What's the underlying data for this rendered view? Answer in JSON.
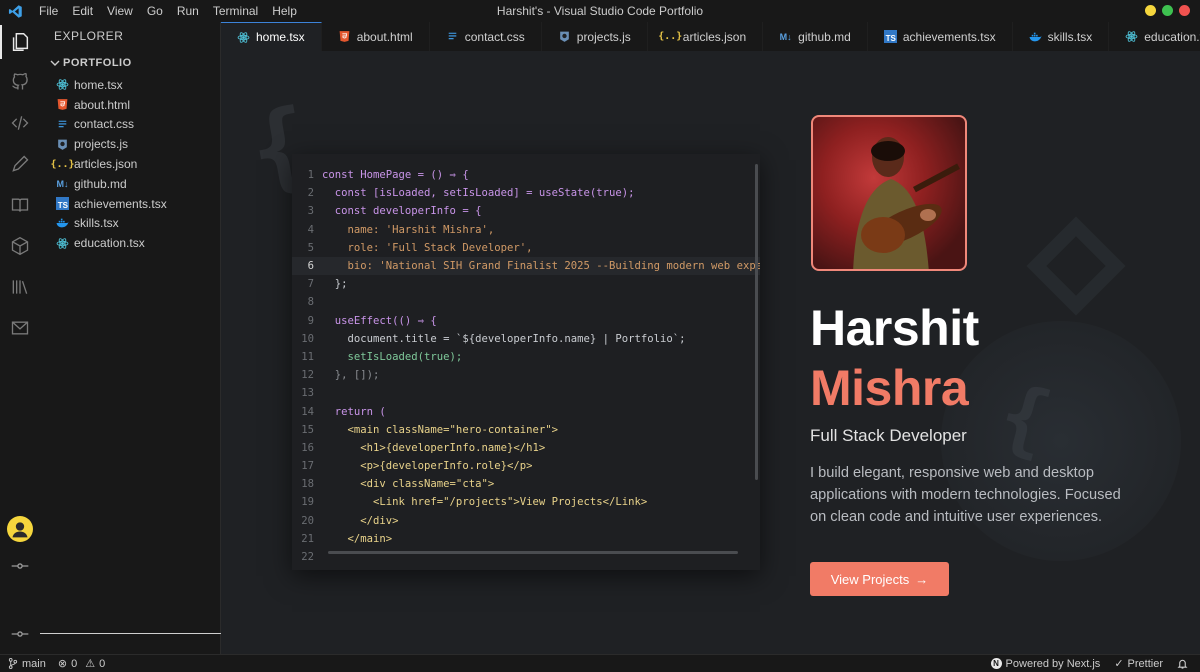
{
  "window": {
    "menu": [
      "File",
      "Edit",
      "View",
      "Go",
      "Run",
      "Terminal",
      "Help"
    ],
    "title": "Harshit's - Visual Studio Code Portfolio",
    "traffic_colors": [
      "#f5d63d",
      "#3ec150",
      "#f0524f"
    ]
  },
  "activity_bar": {
    "icons": [
      "files-icon",
      "github-icon",
      "code-icon",
      "pencil-icon",
      "book-icon",
      "cube-icon",
      "library-icon",
      "mail-icon",
      "avatar",
      "git-commit-icon"
    ]
  },
  "explorer": {
    "title": "EXPLORER",
    "section": "PORTFOLIO",
    "files": [
      {
        "name": "home.tsx",
        "icon": "react-icon"
      },
      {
        "name": "about.html",
        "icon": "html-icon"
      },
      {
        "name": "contact.css",
        "icon": "css-icon"
      },
      {
        "name": "projects.js",
        "icon": "js-icon"
      },
      {
        "name": "articles.json",
        "icon": "json-icon"
      },
      {
        "name": "github.md",
        "icon": "markdown-icon"
      },
      {
        "name": "achievements.tsx",
        "icon": "typescript-icon"
      },
      {
        "name": "skills.tsx",
        "icon": "docker-icon"
      },
      {
        "name": "education.tsx",
        "icon": "react-icon"
      }
    ]
  },
  "tabs": [
    {
      "label": "home.tsx",
      "icon": "react-icon",
      "active": true
    },
    {
      "label": "about.html",
      "icon": "html-icon"
    },
    {
      "label": "contact.css",
      "icon": "css-icon"
    },
    {
      "label": "projects.js",
      "icon": "js-icon"
    },
    {
      "label": "articles.json",
      "icon": "json-icon"
    },
    {
      "label": "github.md",
      "icon": "markdown-icon"
    },
    {
      "label": "achievements.tsx",
      "icon": "typescript-icon"
    },
    {
      "label": "skills.tsx",
      "icon": "docker-icon"
    },
    {
      "label": "education.tsx",
      "icon": "react-icon"
    }
  ],
  "code": {
    "active_line": 6,
    "lines": [
      "const HomePage = () ⇒ {",
      "  const [isLoaded, setIsLoaded] = useState(true);",
      "  const developerInfo = {",
      "    name: 'Harshit Mishra',",
      "    role: 'Full Stack Developer',",
      "    bio: 'National SIH Grand Finalist 2025 --Building modern web expe",
      "  };",
      "",
      "  useEffect(() ⇒ {",
      "    document.title = `${developerInfo.name} | Portfolio`;",
      "    setIsLoaded(true);",
      "  }, []);",
      "",
      "  return (",
      "    <main className=\"hero-container\">",
      "      <h1>{developerInfo.name}</h1>",
      "      <p>{developerInfo.role}</p>",
      "      <div className=\"cta\">",
      "        <Link href=\"/projects\">View Projects</Link>",
      "      </div>",
      "    </main>",
      ""
    ]
  },
  "hero": {
    "first_name": "Harshit",
    "last_name": "Mishra",
    "role": "Full Stack Developer",
    "description": "I build elegant, responsive web and desktop applications with modern technologies. Focused on clean code and intuitive user experiences.",
    "cta_label": "View Projects",
    "cta_arrow": "→",
    "accent": "#f17b66"
  },
  "status": {
    "branch": "main",
    "errors": "0",
    "warnings": "0",
    "powered": "Powered by Next.js",
    "formatter": "Prettier"
  }
}
